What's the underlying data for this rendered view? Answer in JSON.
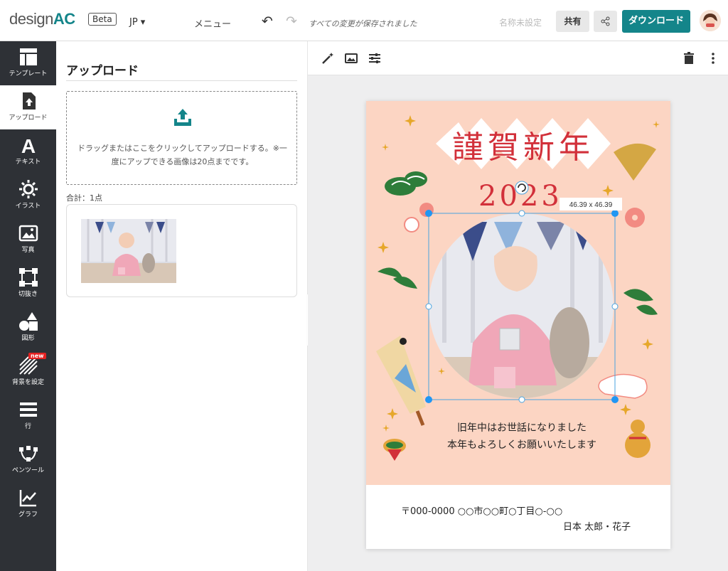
{
  "app": {
    "logo_text": "design",
    "logo_accent": "AC",
    "beta_label": "Beta",
    "brand_color": "#14858a"
  },
  "header": {
    "lang": "JP ▾",
    "menu": "メニュー",
    "saved_status": "すべての変更が保存されました",
    "doc_name": "名称未設定",
    "share": "共有",
    "download": "ダウンロード"
  },
  "sidebar": {
    "items": [
      {
        "label": "テンプレート",
        "icon": "template-icon"
      },
      {
        "label": "アップロード",
        "icon": "upload-icon"
      },
      {
        "label": "テキスト",
        "icon": "text-icon"
      },
      {
        "label": "イラスト",
        "icon": "illustration-icon"
      },
      {
        "label": "写真",
        "icon": "photo-icon"
      },
      {
        "label": "切抜き",
        "icon": "crop-icon"
      },
      {
        "label": "図形",
        "icon": "shapes-icon"
      },
      {
        "label": "背景を設定",
        "icon": "background-icon",
        "badge": "new"
      },
      {
        "label": "行",
        "icon": "lines-icon"
      },
      {
        "label": "ペンツール",
        "icon": "pen-tool-icon"
      },
      {
        "label": "グラフ",
        "icon": "chart-icon"
      }
    ]
  },
  "panel": {
    "title": "アップロード",
    "drop_text": "ドラッグまたはここをクリックしてアップロードする。※一度にアップできる画像は20点までです。",
    "total": "合計：1点"
  },
  "card": {
    "title": "謹賀新年",
    "year": "2023",
    "size_label": "46.39 x 46.39",
    "message_line1": "旧年中はお世話になりました",
    "message_line2": "本年もよろしくお願いいたします",
    "address_line": "〒000-0000 ○○市○○町○丁目○-○○",
    "name_line": "日本 太郎・花子",
    "bg_color": "#fcd5c3",
    "title_color": "#d2303a"
  }
}
